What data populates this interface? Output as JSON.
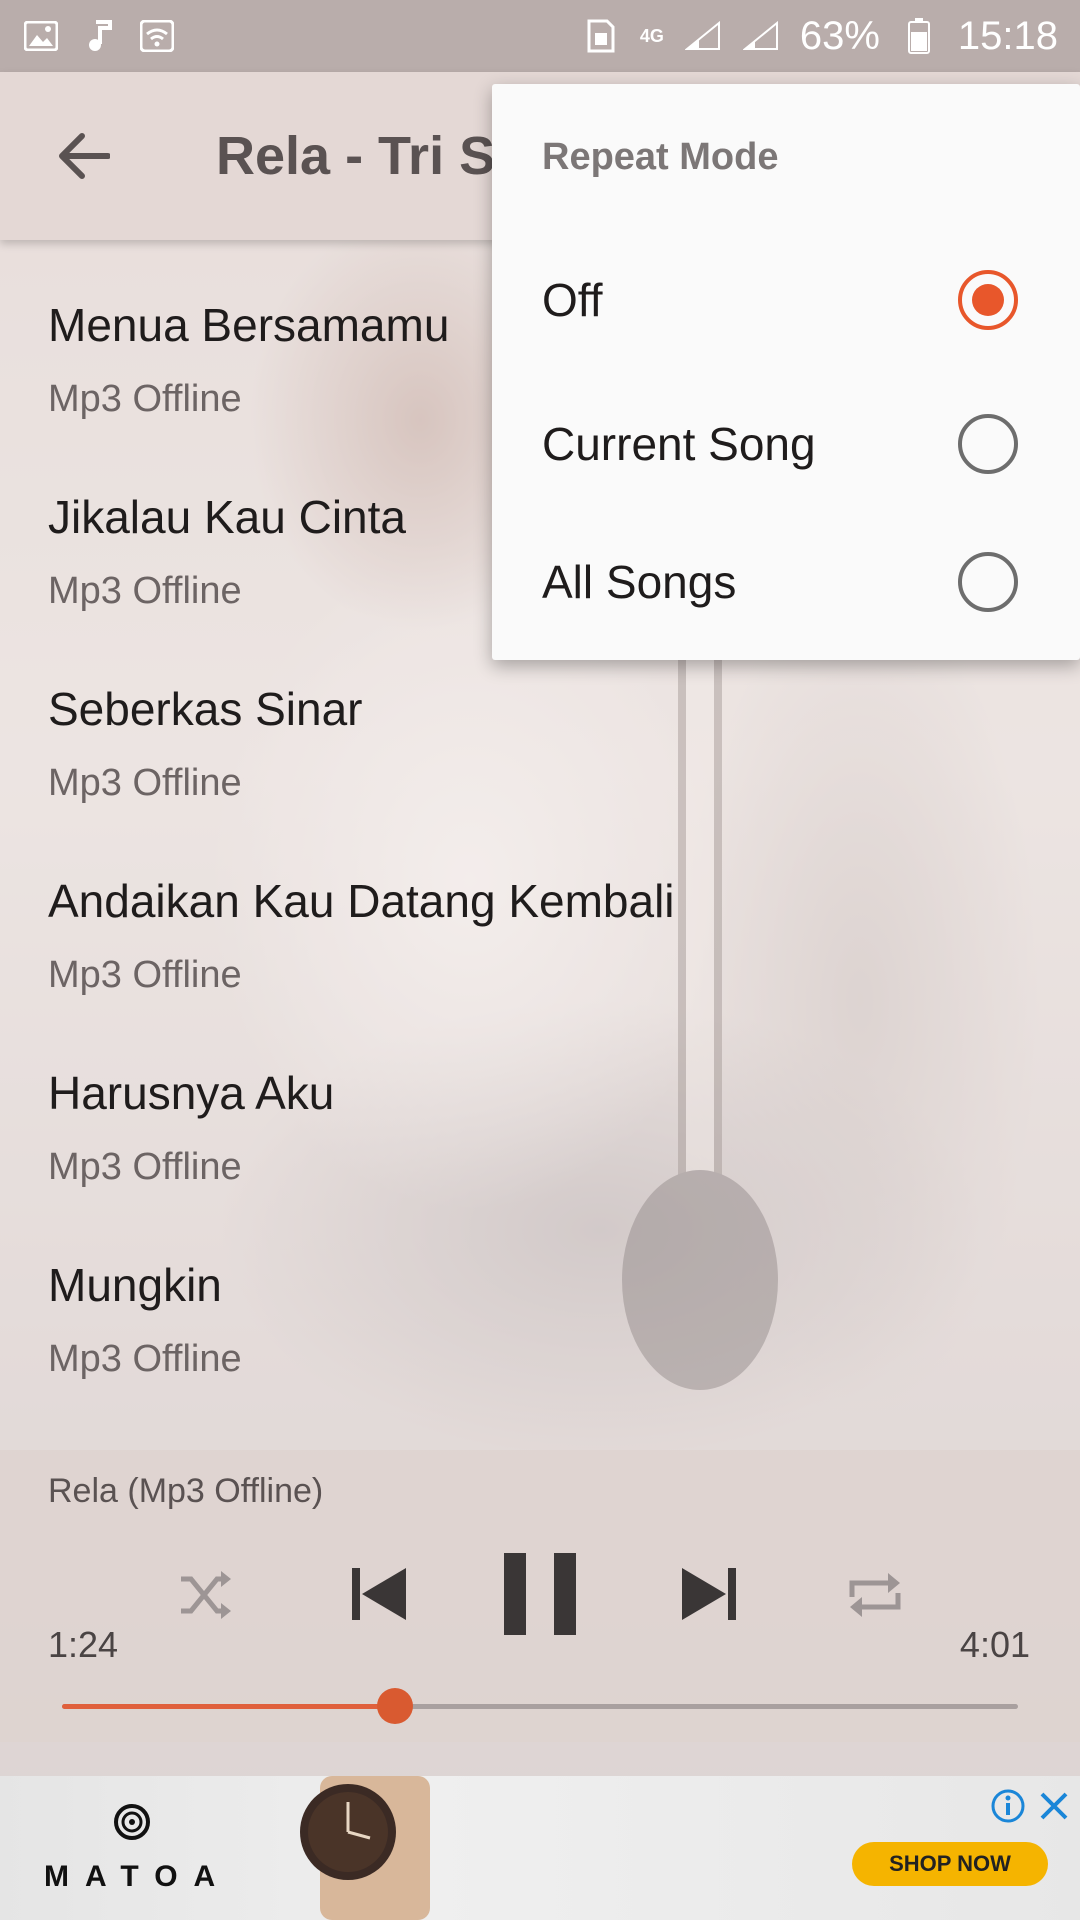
{
  "status_bar": {
    "network": "4G",
    "battery": "63%",
    "time": "15:18"
  },
  "app_bar": {
    "title": "Rela - Tri S"
  },
  "songs": [
    {
      "title": "Menua Bersamamu",
      "subtitle": "Mp3 Offline"
    },
    {
      "title": "Jikalau Kau Cinta",
      "subtitle": "Mp3 Offline"
    },
    {
      "title": "Seberkas Sinar",
      "subtitle": "Mp3 Offline"
    },
    {
      "title": "Andaikan Kau Datang Kembali",
      "subtitle": "Mp3 Offline"
    },
    {
      "title": "Harusnya Aku",
      "subtitle": "Mp3 Offline"
    },
    {
      "title": "Mungkin",
      "subtitle": "Mp3 Offline"
    }
  ],
  "repeat_menu": {
    "title": "Repeat Mode",
    "options": [
      {
        "label": "Off",
        "checked": true
      },
      {
        "label": "Current Song",
        "checked": false
      },
      {
        "label": "All Songs",
        "checked": false
      }
    ],
    "accent_color": "#e8572b"
  },
  "player": {
    "now_playing": "Rela (Mp3 Offline)",
    "elapsed": "1:24",
    "duration": "4:01",
    "progress": 0.348,
    "controls": [
      "shuffle-icon",
      "skip-previous-icon",
      "pause-icon",
      "skip-next-icon",
      "repeat-icon"
    ]
  },
  "ad": {
    "brand": "MATOA",
    "cta": "SHOP NOW",
    "cta_color": "#f5b400"
  }
}
